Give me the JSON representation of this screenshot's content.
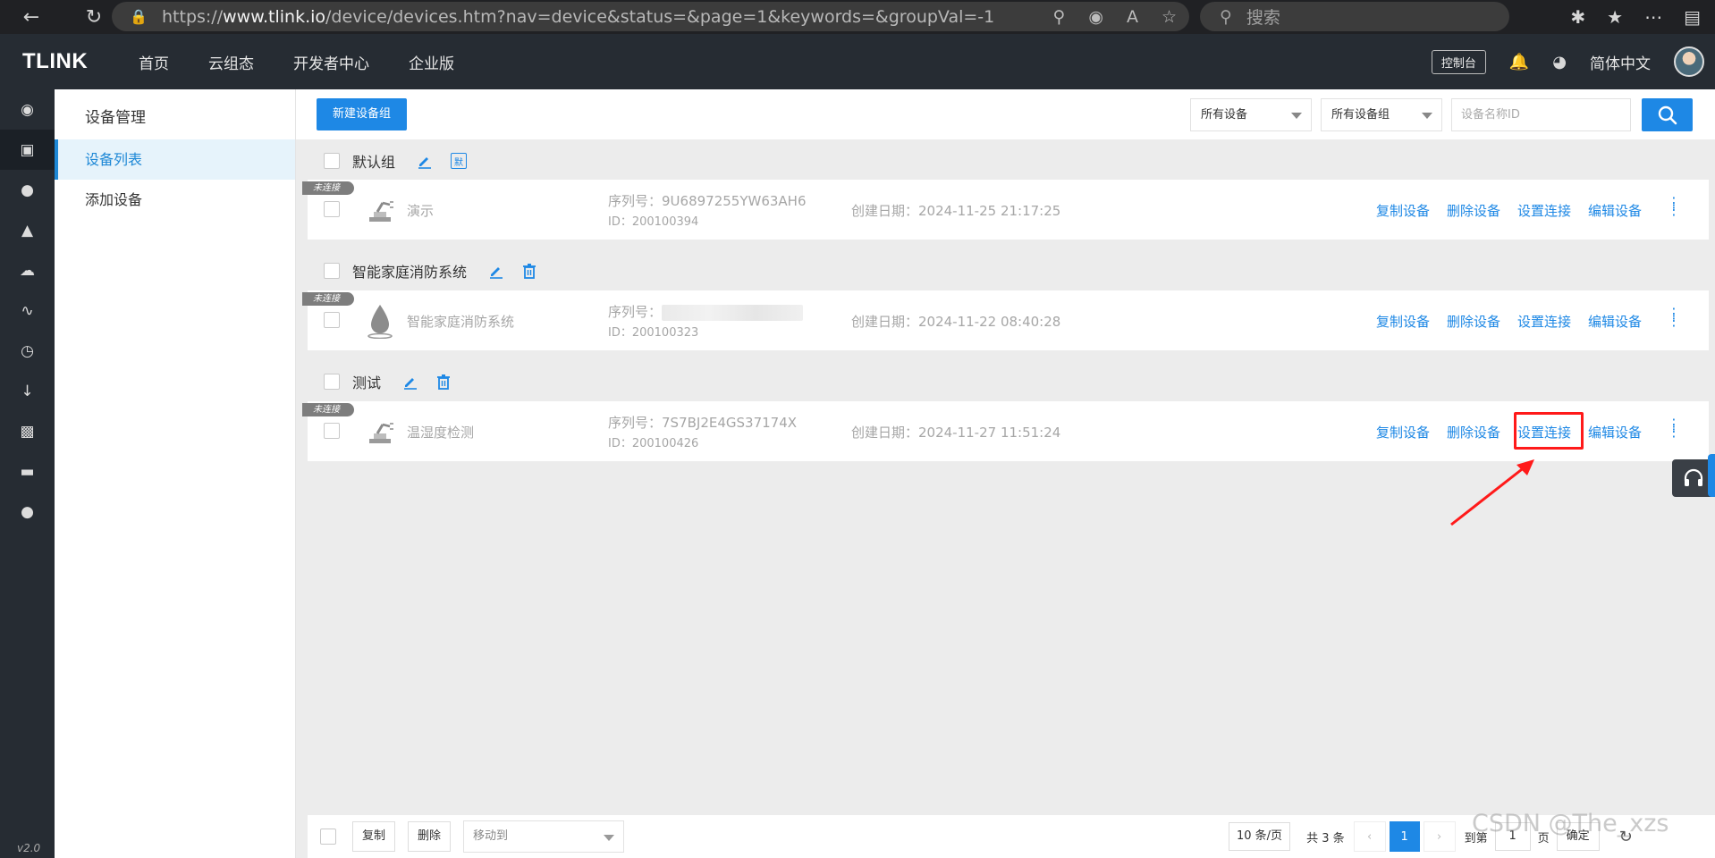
{
  "browser": {
    "url_prefix": "https://",
    "url_host": "www.tlink.io",
    "url_path": "/device/devices.htm?nav=device&status=&page=1&keywords=&groupVal=-1",
    "search_placeholder": "搜索"
  },
  "topnav": {
    "logo": "TLINK",
    "items": [
      "首页",
      "云组态",
      "开发者中心",
      "企业版"
    ],
    "console": "控制台",
    "language": "简体中文"
  },
  "rail": {
    "version": "v2.0"
  },
  "sidebar": {
    "title": "设备管理",
    "items": [
      {
        "label": "设备列表",
        "active": true
      },
      {
        "label": "添加设备",
        "active": false
      }
    ]
  },
  "toolbar": {
    "new_group": "新建设备组",
    "filter_devices": "所有设备",
    "filter_groups": "所有设备组",
    "search_placeholder": "设备名称ID"
  },
  "groups": [
    {
      "name": "默认组",
      "badge": "默",
      "device": {
        "status_tag": "未连接",
        "name": "演示",
        "serial_label": "序列号：",
        "serial": "9U6897255YW63AH6",
        "id": "ID：200100394",
        "date": "创建日期：2024-11-25 21:17:25",
        "icon": "robot-arm-icon"
      }
    },
    {
      "name": "智能家庭消防系统",
      "device": {
        "status_tag": "未连接",
        "name": "智能家庭消防系统",
        "serial_label": "序列号：",
        "serial": "",
        "id": "ID：200100323",
        "date": "创建日期：2024-11-22 08:40:28",
        "icon": "water-drop-icon"
      }
    },
    {
      "name": "测试",
      "device": {
        "status_tag": "未连接",
        "name": "温湿度检测",
        "serial_label": "序列号：",
        "serial": "7S7BJ2E4GS37174X",
        "id": "ID：200100426",
        "date": "创建日期：2024-11-27 11:51:24",
        "icon": "robot-arm-icon"
      }
    }
  ],
  "actions": {
    "copy": "复制设备",
    "delete": "删除设备",
    "connect": "设置连接",
    "edit": "编辑设备"
  },
  "footer": {
    "copy": "复制",
    "delete": "删除",
    "move_to": "移动到",
    "per_page": "10 条/页",
    "total": "共 3 条",
    "current_page": "1",
    "goto_label": "到第",
    "goto_value": "1",
    "page_unit": "页",
    "confirm": "确定"
  },
  "watermark": "CSDN @The_xzs",
  "colors": {
    "accent": "#1e88e5",
    "highlight": "#ff1a1a",
    "nav_bg": "#262c33"
  }
}
